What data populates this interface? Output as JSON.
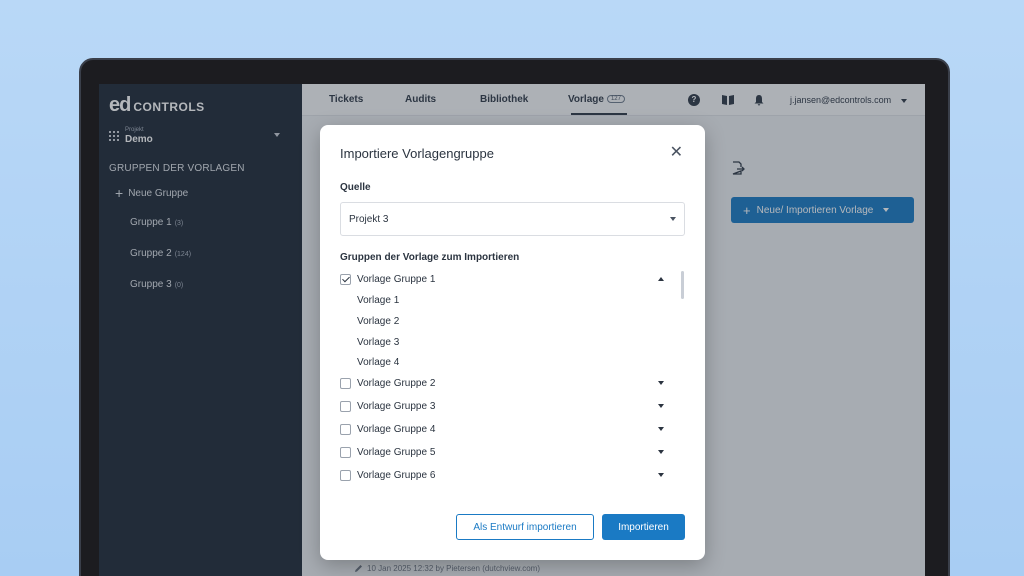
{
  "brand": {
    "logo_ed": "ed",
    "logo_controls": "CONTROLS"
  },
  "sidebar": {
    "project_label": "Projekt",
    "project_name": "Demo",
    "groups_heading": "GRUPPEN DER VORLAGEN",
    "new_group": "Neue Gruppe",
    "groups": [
      {
        "label": "Gruppe 1",
        "count": "(3)"
      },
      {
        "label": "Gruppe 2",
        "count": "(124)"
      },
      {
        "label": "Gruppe 3",
        "count": "(0)"
      }
    ]
  },
  "topbar": {
    "tabs": [
      "Tickets",
      "Audits",
      "Bibliothek",
      "Vorlage"
    ],
    "vorlage_badge": "127",
    "user": "j.jansen@edcontrols.com"
  },
  "main": {
    "new_template_button": "Neue/ Importieren Vorlage",
    "footer_note": "10 Jan 2025 12:32 by Pietersen (dutchview.com)"
  },
  "modal": {
    "title": "Importiere Vorlagengruppe",
    "source_label": "Quelle",
    "source_value": "Projekt 3",
    "groups_label": "Gruppen der Vorlage zum Importieren",
    "groups": [
      {
        "label": "Vorlage Gruppe 1",
        "checked": true,
        "expanded": true,
        "items": [
          "Vorlage 1",
          "Vorlage 2",
          "Vorlage 3",
          "Vorlage 4"
        ]
      },
      {
        "label": "Vorlage Gruppe 2",
        "checked": false,
        "expanded": false
      },
      {
        "label": "Vorlage Gruppe 3",
        "checked": false,
        "expanded": false
      },
      {
        "label": "Vorlage Gruppe 4",
        "checked": false,
        "expanded": false
      },
      {
        "label": "Vorlage Gruppe 5",
        "checked": false,
        "expanded": false
      },
      {
        "label": "Vorlage Gruppe 6",
        "checked": false,
        "expanded": false
      }
    ],
    "draft_button": "Als Entwurf importieren",
    "import_button": "Importieren"
  },
  "colors": {
    "accent": "#1a7ac4",
    "sidebar_bg": "#1f2a38"
  }
}
